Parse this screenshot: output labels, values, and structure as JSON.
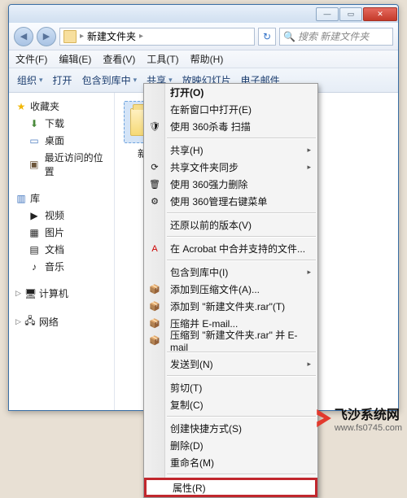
{
  "titlebar": {
    "min": "—",
    "max": "▭",
    "close": "✕"
  },
  "nav": {
    "back": "◀",
    "fwd": "▶",
    "breadcrumb_label": "新建文件夹",
    "breadcrumb_arrow": "▸",
    "reload_icon": "↻",
    "search_placeholder": "搜索 新建文件夹",
    "search_icon": "🔍"
  },
  "menubar": [
    "文件(F)",
    "编辑(E)",
    "查看(V)",
    "工具(T)",
    "帮助(H)"
  ],
  "toolbar": {
    "items": [
      "组织",
      "打开",
      "包含到库中",
      "共享",
      "放映幻灯片",
      "电子邮件"
    ],
    "dd": "▾"
  },
  "sidebar": {
    "fav_title": "收藏夹",
    "fav": [
      "下载",
      "桌面",
      "最近访问的位置"
    ],
    "lib_title": "库",
    "lib": [
      "视频",
      "图片",
      "文档",
      "音乐"
    ],
    "computer": "计算机",
    "network": "网络",
    "chev": "▷"
  },
  "content": {
    "folder_name": "新建"
  },
  "ctx": {
    "open": "打开(O)",
    "open_new_window": "在新窗口中打开(E)",
    "scan_360": "使用 360杀毒 扫描",
    "share": "共享(H)",
    "share_sync": "共享文件夹同步",
    "force_del_360": "使用 360强力删除",
    "manage_menu_360": "使用 360管理右键菜单",
    "prev_versions": "还原以前的版本(V)",
    "acrobat_combine": "在 Acrobat 中合并支持的文件...",
    "include_in_lib": "包含到库中(I)",
    "add_to_archive": "添加到压缩文件(A)...",
    "add_to_archive_named": "添加到 \"新建文件夹.rar\"(T)",
    "compress_email": "压缩并 E-mail...",
    "compress_named_email": "压缩到 \"新建文件夹.rar\" 并 E-mail",
    "send_to": "发送到(N)",
    "cut": "剪切(T)",
    "copy": "复制(C)",
    "create_shortcut": "创建快捷方式(S)",
    "delete": "删除(D)",
    "rename": "重命名(M)",
    "properties": "属性(R)",
    "arrow": "▸"
  },
  "watermark": {
    "name": "飞沙系统网",
    "url": "www.fs0745.com"
  }
}
